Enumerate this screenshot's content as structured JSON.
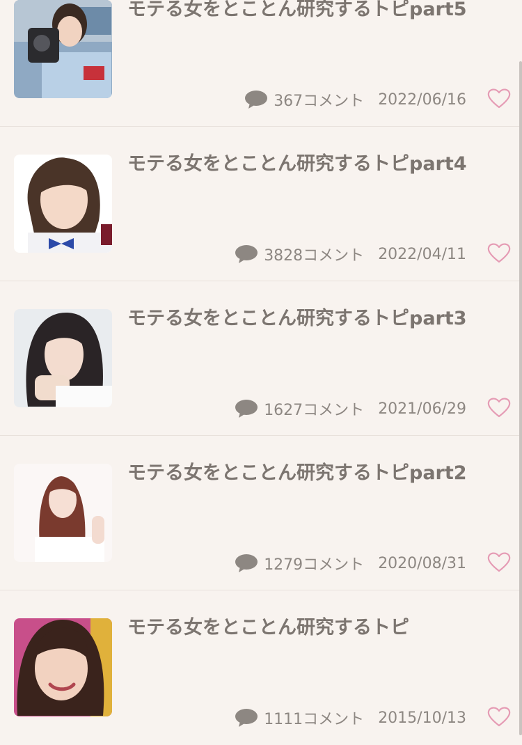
{
  "topics": [
    {
      "title": "モテる女をとことん研究するトピpart5",
      "comments": "367コメント",
      "date": "2022/06/16",
      "thumb_icon": "photo-woman-stadium"
    },
    {
      "title": "モテる女をとことん研究するトピpart4",
      "comments": "3828コメント",
      "date": "2022/04/11",
      "thumb_icon": "photo-woman-bob"
    },
    {
      "title": "モテる女をとことん研究するトピpart3",
      "comments": "1627コメント",
      "date": "2021/06/29",
      "thumb_icon": "photo-woman-longhair"
    },
    {
      "title": "モテる女をとことん研究するトピpart2",
      "comments": "1279コメント",
      "date": "2020/08/31",
      "thumb_icon": "photo-woman-brown-hair"
    },
    {
      "title": "モテる女をとことん研究するトピ",
      "comments": "1111コメント",
      "date": "2015/10/13",
      "thumb_icon": "photo-woman-smile"
    }
  ],
  "colors": {
    "background": "#f8f3ef",
    "title": "#7c7570",
    "meta": "#8d8782",
    "heart": "#e59bb4",
    "comment_icon": "#8d8782"
  }
}
